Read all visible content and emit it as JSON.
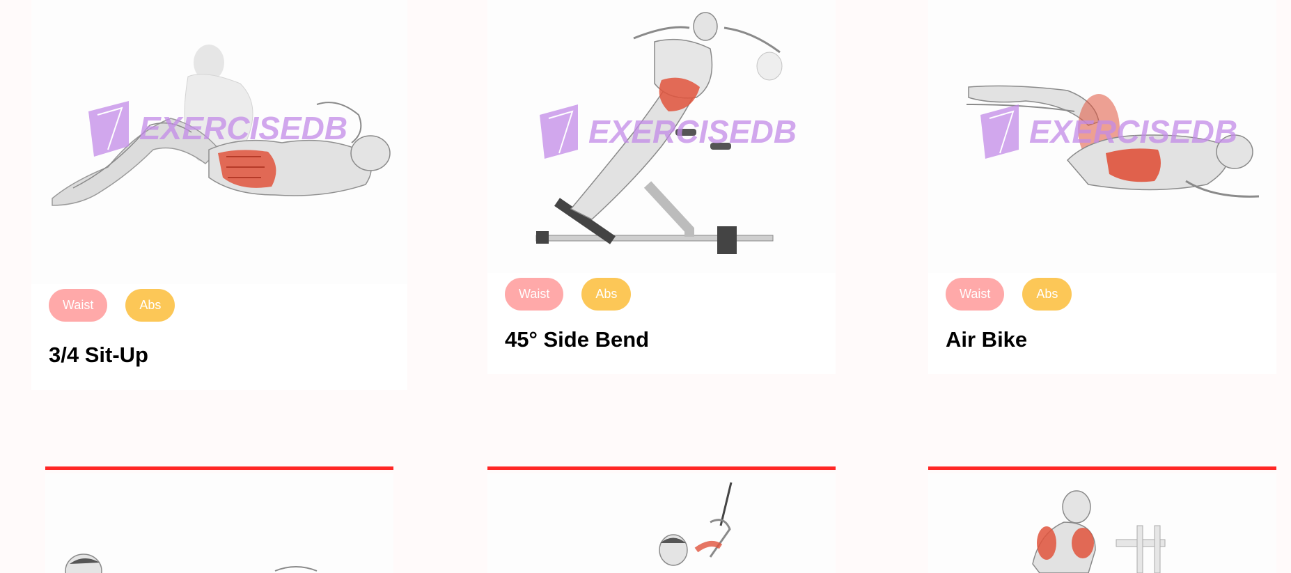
{
  "colors": {
    "page_bg": "#fffafa",
    "tag_waist": "#ffa9a9",
    "tag_abs": "#fcc757",
    "accent_line": "#ff2625",
    "watermark": "#c38be8",
    "muscle_highlight": "#e0533c"
  },
  "watermark_text": "EXERCISEDB",
  "cards": [
    {
      "name": "3/4 Sit-Up",
      "tags": [
        "Waist",
        "Abs"
      ],
      "image_icon": "sit-up-illustration"
    },
    {
      "name": "45° Side Bend",
      "tags": [
        "Waist",
        "Abs"
      ],
      "image_icon": "side-bend-illustration"
    },
    {
      "name": "Air Bike",
      "tags": [
        "Waist",
        "Abs"
      ],
      "image_icon": "air-bike-illustration"
    }
  ],
  "next_row": [
    {
      "image_icon": "exercise-illustration"
    },
    {
      "image_icon": "cable-exercise-illustration"
    },
    {
      "image_icon": "dip-station-illustration"
    }
  ]
}
